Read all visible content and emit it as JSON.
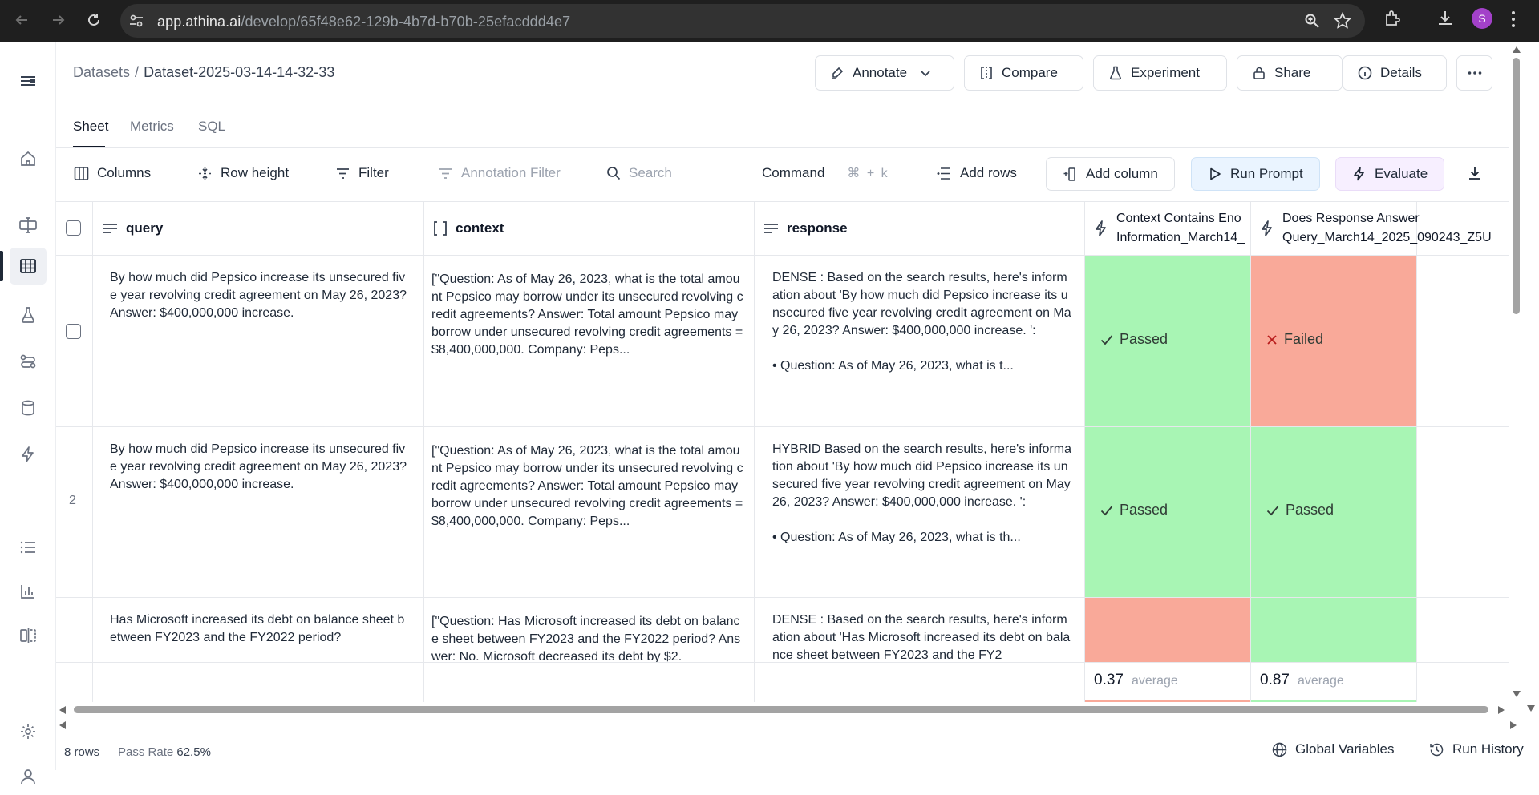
{
  "browser": {
    "url_host": "app.athina.ai",
    "url_path": "/develop/65f48e62-129b-4b7d-b70b-25efacddd4e7",
    "profile_initial": "S"
  },
  "breadcrumb": {
    "root": "Datasets",
    "separator": "/",
    "current": "Dataset-2025-03-14-14-32-33"
  },
  "header_buttons": {
    "annotate": "Annotate",
    "compare": "Compare",
    "experiment": "Experiment",
    "share": "Share",
    "details": "Details"
  },
  "tabs": [
    {
      "label": "Sheet"
    },
    {
      "label": "Metrics"
    },
    {
      "label": "SQL"
    }
  ],
  "toolbar": {
    "columns": "Columns",
    "row_height": "Row height",
    "filter": "Filter",
    "annotation_filter": "Annotation Filter",
    "search_placeholder": "Search",
    "command": "Command",
    "command_shortcut": "⌘ + k",
    "add_rows": "Add rows",
    "add_column": "Add column",
    "run_prompt": "Run Prompt",
    "evaluate": "Evaluate"
  },
  "columns": {
    "query": "query",
    "context": "context",
    "response": "response",
    "eval1": {
      "line1": "Context Contains Eno",
      "line2": "Information_March14_"
    },
    "eval2": {
      "line1": "Does Response Answer",
      "line2": "Query_March14_2025_090243_Z5U"
    }
  },
  "rows": [
    {
      "number": "",
      "query": "By how much did Pepsico increase its unsecured five year revolving credit agreement on May 26, 2023? Answer: $400,000,000 increase.",
      "context": "[\"Question: As of May 26, 2023, what is the total amount Pepsico may borrow under its unsecured revolving credit agreements? Answer: Total amount Pepsico may borrow under unsecured revolving credit agreements = $8,400,000,000. Company: Peps...",
      "response_p1": "DENSE : Based on the search results, here's information about 'By how much did Pepsico increase its unsecured five year revolving credit agreement on May 26, 2023? Answer: $400,000,000 increase. ':",
      "response_p2": "• Question: As of May 26, 2023, what is t...",
      "eval1": "Passed",
      "eval2": "Failed"
    },
    {
      "number": "2",
      "query": "By how much did Pepsico increase its unsecured five year revolving credit agreement on May 26, 2023? Answer: $400,000,000 increase.",
      "context": "[\"Question: As of May 26, 2023, what is the total amount Pepsico may borrow under its unsecured revolving credit agreements? Answer: Total amount Pepsico may borrow under unsecured revolving credit agreements = $8,400,000,000. Company: Peps...",
      "response_p1": "HYBRID Based on the search results, here's information about 'By how much did Pepsico increase its unsecured five year revolving credit agreement on May 26, 2023? Answer: $400,000,000 increase. ':",
      "response_p2": "• Question: As of May 26, 2023, what is th...",
      "eval1": "Passed",
      "eval2": "Passed"
    },
    {
      "number": "",
      "query": "Has Microsoft increased its debt on balance sheet between FY2023 and the FY2022 period?",
      "context": "[\"Question: Has Microsoft increased its debt on balance sheet between FY2023 and the FY2022 period? Answer: No. Microsoft decreased its debt by $2.",
      "response_p1": "DENSE : Based on the search results, here's information about 'Has Microsoft increased its debt on balance sheet between FY2023 and the FY2",
      "eval1": "",
      "eval2": ""
    }
  ],
  "averages": {
    "eval1": {
      "value": "0.37",
      "label": "average"
    },
    "eval2": {
      "value": "0.87",
      "label": "average"
    }
  },
  "footer": {
    "rows_count": "8 rows",
    "pass_rate_label": "Pass Rate",
    "pass_rate_value": "62.5%",
    "global_variables": "Global Variables",
    "run_history": "Run History"
  },
  "colors": {
    "passed": "#a8f5b4",
    "failed": "#f9a999",
    "run_prompt_bg": "#eaf4ff",
    "evaluate_bg": "#f7efff"
  }
}
